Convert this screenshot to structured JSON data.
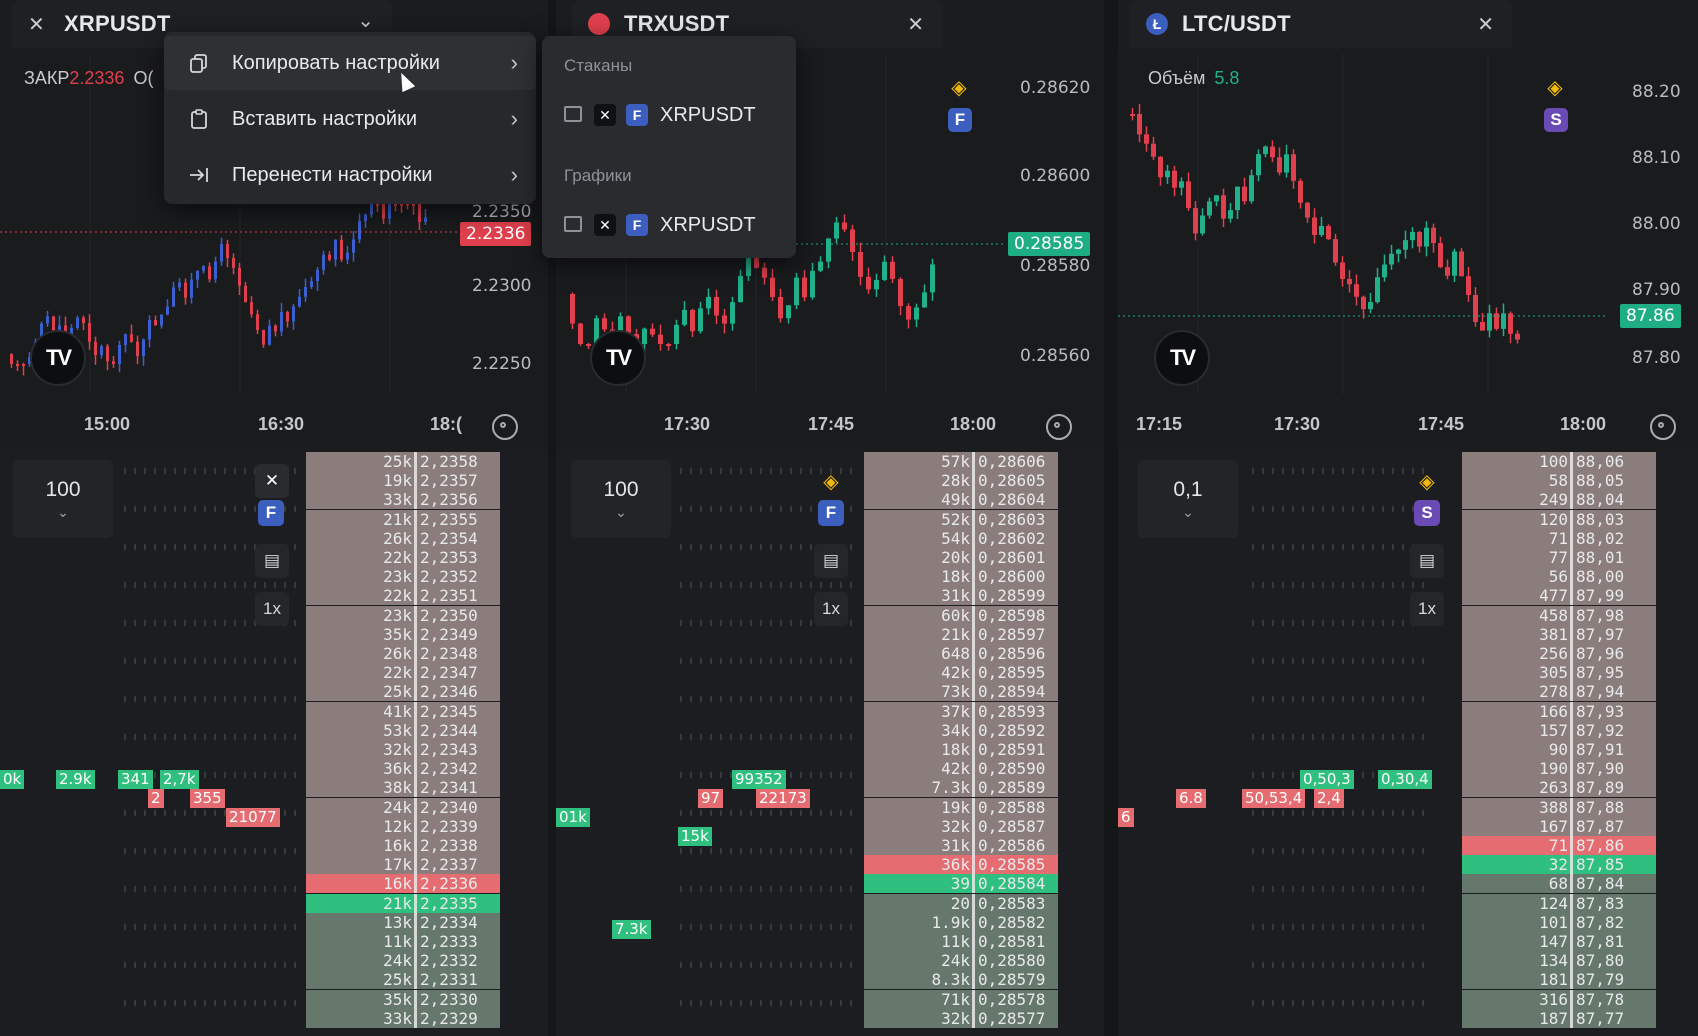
{
  "panels": [
    {
      "tab_title": "XRPUSDT",
      "close_glyph": "✕",
      "ohlc_label": "ЗАКР",
      "ohlc_value": "2.2336",
      "ohlc_more": "О(",
      "price_labels": [
        "2.2350",
        "2.2300",
        "2.2250"
      ],
      "last_price": "2.2336",
      "time_labels": [
        "15:00",
        "16:30",
        "18:("
      ],
      "step_value": "100",
      "side_buttons": [
        "F",
        "1x"
      ],
      "ladder": [
        {
          "vol": "25k",
          "price": "2,2358"
        },
        {
          "vol": "19k",
          "price": "2,2357"
        },
        {
          "vol": "33k",
          "price": "2,2356"
        },
        {
          "vol": "21k",
          "price": "2,2355"
        },
        {
          "vol": "26k",
          "price": "2,2354"
        },
        {
          "vol": "22k",
          "price": "2,2353"
        },
        {
          "vol": "23k",
          "price": "2,2352"
        },
        {
          "vol": "22k",
          "price": "2,2351"
        },
        {
          "vol": "23k",
          "price": "2,2350"
        },
        {
          "vol": "35k",
          "price": "2,2349"
        },
        {
          "vol": "26k",
          "price": "2,2348"
        },
        {
          "vol": "22k",
          "price": "2,2347"
        },
        {
          "vol": "25k",
          "price": "2,2346"
        },
        {
          "vol": "41k",
          "price": "2,2345"
        },
        {
          "vol": "53k",
          "price": "2,2344"
        },
        {
          "vol": "32k",
          "price": "2,2343"
        },
        {
          "vol": "36k",
          "price": "2,2342"
        },
        {
          "vol": "38k",
          "price": "2,2341"
        },
        {
          "vol": "24k",
          "price": "2,2340"
        },
        {
          "vol": "12k",
          "price": "2,2339"
        },
        {
          "vol": "16k",
          "price": "2,2338"
        },
        {
          "vol": "17k",
          "price": "2,2337"
        },
        {
          "vol": "16k",
          "price": "2,2336",
          "best": "ask"
        },
        {
          "vol": "21k",
          "price": "2,2335",
          "best": "bid"
        },
        {
          "vol": "13k",
          "price": "2,2334"
        },
        {
          "vol": "11k",
          "price": "2,2333"
        },
        {
          "vol": "24k",
          "price": "2,2332"
        },
        {
          "vol": "25k",
          "price": "2,2331"
        },
        {
          "vol": "35k",
          "price": "2,2330"
        },
        {
          "vol": "33k",
          "price": "2,2329"
        }
      ],
      "clusters": [
        "0k",
        "2.9k",
        "341",
        "2,7k",
        "2",
        "355",
        "21077"
      ]
    },
    {
      "tab_title": "TRXUSDT",
      "close_glyph": "✕",
      "price_labels": [
        "0.28620",
        "0.28600",
        "0.28580",
        "0.28560"
      ],
      "last_price": "0.28585",
      "time_labels": [
        "17:30",
        "17:45",
        "18:00"
      ],
      "step_value": "100",
      "side_buttons": [
        "F",
        "1x"
      ],
      "ladder": [
        {
          "vol": "57k",
          "price": "0,28606"
        },
        {
          "vol": "28k",
          "price": "0,28605"
        },
        {
          "vol": "49k",
          "price": "0,28604"
        },
        {
          "vol": "52k",
          "price": "0,28603"
        },
        {
          "vol": "54k",
          "price": "0,28602"
        },
        {
          "vol": "20k",
          "price": "0,28601"
        },
        {
          "vol": "18k",
          "price": "0,28600"
        },
        {
          "vol": "31k",
          "price": "0,28599"
        },
        {
          "vol": "60k",
          "price": "0,28598"
        },
        {
          "vol": "21k",
          "price": "0,28597"
        },
        {
          "vol": "648",
          "price": "0,28596"
        },
        {
          "vol": "42k",
          "price": "0,28595"
        },
        {
          "vol": "73k",
          "price": "0,28594"
        },
        {
          "vol": "37k",
          "price": "0,28593"
        },
        {
          "vol": "34k",
          "price": "0,28592"
        },
        {
          "vol": "18k",
          "price": "0,28591"
        },
        {
          "vol": "42k",
          "price": "0,28590"
        },
        {
          "vol": "7.3k",
          "price": "0,28589"
        },
        {
          "vol": "19k",
          "price": "0,28588"
        },
        {
          "vol": "32k",
          "price": "0,28587"
        },
        {
          "vol": "31k",
          "price": "0,28586"
        },
        {
          "vol": "36k",
          "price": "0,28585",
          "best": "ask"
        },
        {
          "vol": "39",
          "price": "0,28584",
          "best": "bid"
        },
        {
          "vol": "20",
          "price": "0,28583"
        },
        {
          "vol": "1.9k",
          "price": "0,28582"
        },
        {
          "vol": "11k",
          "price": "0,28581"
        },
        {
          "vol": "24k",
          "price": "0,28580"
        },
        {
          "vol": "8.3k",
          "price": "0,28579"
        },
        {
          "vol": "71k",
          "price": "0,28578"
        },
        {
          "vol": "32k",
          "price": "0,28577"
        }
      ],
      "clusters": [
        "99352",
        "97",
        "22173",
        "01k",
        "15k",
        "7.3k"
      ]
    },
    {
      "tab_title": "LTC/USDT",
      "close_glyph": "✕",
      "volume_label": "Объём",
      "volume_value": "5.8",
      "price_labels": [
        "88.20",
        "88.10",
        "88.00",
        "87.90",
        "87.80"
      ],
      "last_price": "87.86",
      "time_labels": [
        "17:15",
        "17:30",
        "17:45",
        "18:00"
      ],
      "step_value": "0,1",
      "side_buttons": [
        "S",
        "1x"
      ],
      "ladder": [
        {
          "vol": "100",
          "price": "88,06"
        },
        {
          "vol": "58",
          "price": "88,05"
        },
        {
          "vol": "249",
          "price": "88,04"
        },
        {
          "vol": "120",
          "price": "88,03"
        },
        {
          "vol": "71",
          "price": "88,02"
        },
        {
          "vol": "77",
          "price": "88,01"
        },
        {
          "vol": "56",
          "price": "88,00"
        },
        {
          "vol": "477",
          "price": "87,99"
        },
        {
          "vol": "458",
          "price": "87,98"
        },
        {
          "vol": "381",
          "price": "87,97"
        },
        {
          "vol": "256",
          "price": "87,96"
        },
        {
          "vol": "305",
          "price": "87,95"
        },
        {
          "vol": "278",
          "price": "87,94"
        },
        {
          "vol": "166",
          "price": "87,93"
        },
        {
          "vol": "157",
          "price": "87,92"
        },
        {
          "vol": "90",
          "price": "87,91"
        },
        {
          "vol": "190",
          "price": "87,90"
        },
        {
          "vol": "263",
          "price": "87,89"
        },
        {
          "vol": "388",
          "price": "87,88"
        },
        {
          "vol": "167",
          "price": "87,87"
        },
        {
          "vol": "71",
          "price": "87,86",
          "best": "ask"
        },
        {
          "vol": "32",
          "price": "87,85",
          "best": "bid"
        },
        {
          "vol": "68",
          "price": "87,84"
        },
        {
          "vol": "124",
          "price": "87,83"
        },
        {
          "vol": "101",
          "price": "87,82"
        },
        {
          "vol": "147",
          "price": "87,81"
        },
        {
          "vol": "134",
          "price": "87,80"
        },
        {
          "vol": "181",
          "price": "87,79"
        },
        {
          "vol": "316",
          "price": "87,78"
        },
        {
          "vol": "187",
          "price": "87,77"
        }
      ],
      "clusters": [
        "6",
        "6.8",
        "50,53,4",
        "2,4",
        "0,50,3",
        "0,30,4"
      ]
    }
  ],
  "context_menu": {
    "items": [
      {
        "label": "Копировать настройки",
        "icon": "copy-icon"
      },
      {
        "label": "Вставить настройки",
        "icon": "paste-icon"
      },
      {
        "label": "Перенести настройки",
        "icon": "transfer-icon"
      }
    ],
    "arrow": "›"
  },
  "submenu": {
    "section_books": "Стаканы",
    "section_charts": "Графики",
    "book_item": {
      "badge": "F",
      "label": "XRPUSDT"
    },
    "chart_item": {
      "badge": "F",
      "label": "XRPUSDT"
    }
  },
  "colors": {
    "ask_bg": "#8a7d7b",
    "bid_bg": "#66786c",
    "best_ask": "#e56d72",
    "best_bid": "#2fbf7f",
    "up": "#22b08a",
    "down": "#e0404d",
    "blue": "#4367c7",
    "binance": "#f0b90b"
  }
}
